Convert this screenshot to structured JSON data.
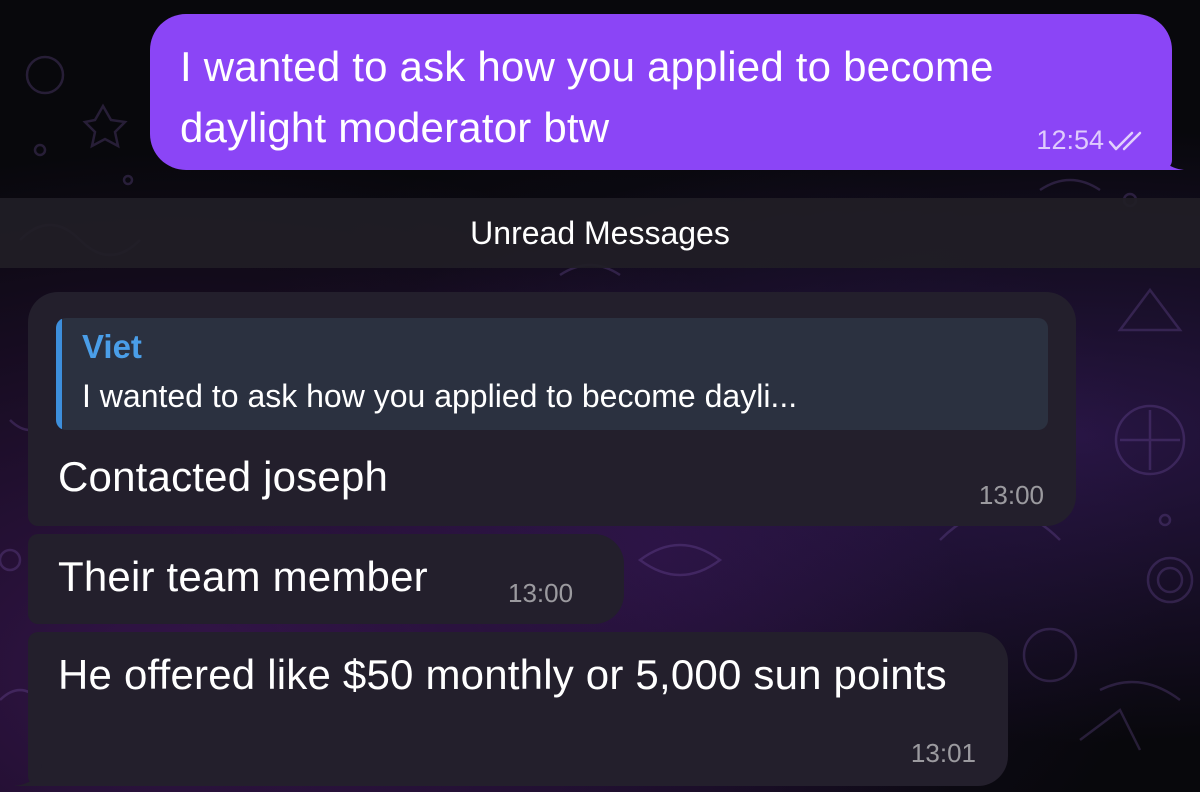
{
  "outgoing": {
    "text": "I wanted to ask how you applied to become daylight moderator btw",
    "time": "12:54",
    "status_icon": "double-check-icon",
    "bubble_color": "#8b45f6"
  },
  "unread_divider": {
    "label": "Unread Messages"
  },
  "incoming": [
    {
      "reply": {
        "author": "Viet",
        "snippet": "I wanted to ask how you applied to become dayli..."
      },
      "text": "Contacted joseph",
      "time": "13:00"
    },
    {
      "text": "Their team member",
      "time": "13:00"
    },
    {
      "text": "He offered like $50 monthly or 5,000 sun points",
      "time": "13:01"
    }
  ],
  "colors": {
    "incoming_bubble": "#231f2c",
    "reply_accent": "#3d8fdc",
    "reply_author": "#4a9ee8"
  }
}
